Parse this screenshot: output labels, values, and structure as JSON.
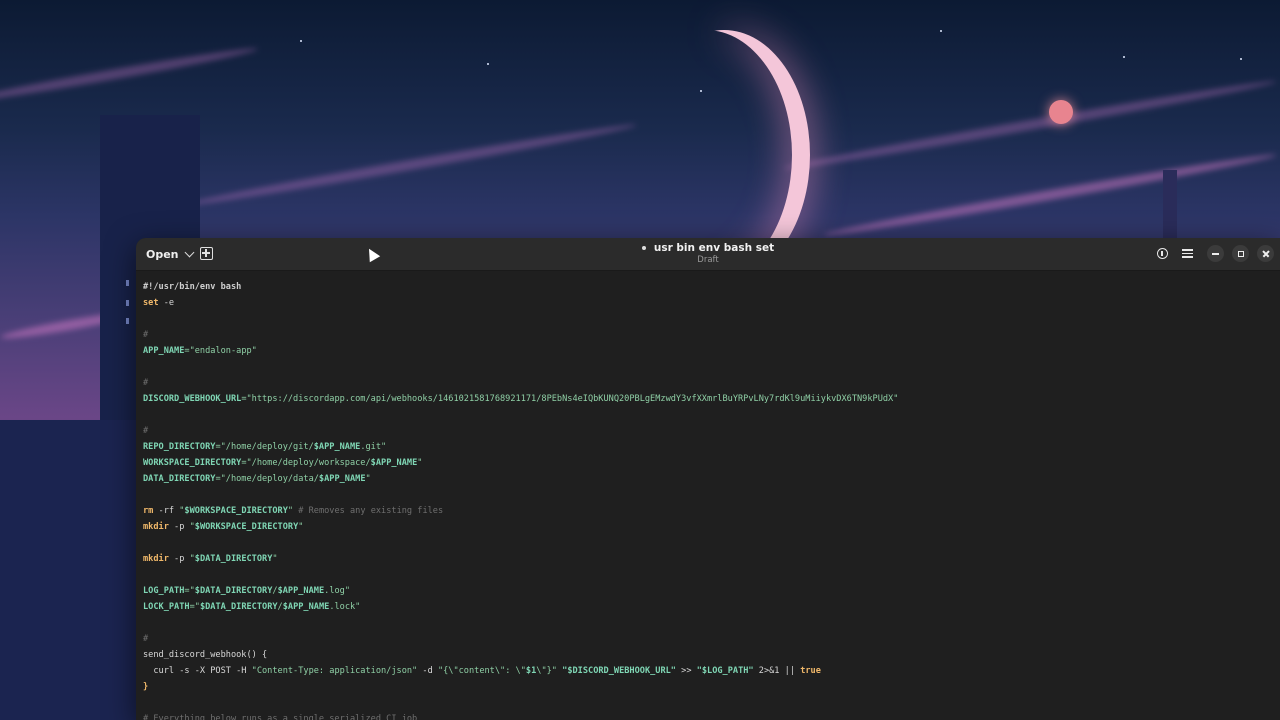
{
  "window": {
    "title": "usr bin env bash set",
    "subtitle": "Draft",
    "open_label": "Open"
  },
  "code_lines": [
    [
      {
        "t": "#!/usr/bin/env bash",
        "c": "shebang"
      }
    ],
    [
      {
        "t": "set",
        "c": "kw"
      },
      {
        "t": " -e",
        "c": "plain"
      }
    ],
    [],
    [
      {
        "t": "#",
        "c": "cmt"
      }
    ],
    [
      {
        "t": "APP_NAME",
        "c": "var"
      },
      {
        "t": "=\"endalon-app\"",
        "c": "str"
      }
    ],
    [],
    [
      {
        "t": "#",
        "c": "cmt"
      }
    ],
    [
      {
        "t": "DISCORD_WEBHOOK_URL",
        "c": "var"
      },
      {
        "t": "=\"https://discordapp.com/api/webhooks/1461021581768921171/8PEbNs4eIQbKUNQ20PBLgEMzwdY3vfXXmrlBuYRPvLNy7rdKl9uMiiykvDX6TN9kPUdX\"",
        "c": "str"
      }
    ],
    [],
    [
      {
        "t": "#",
        "c": "cmt"
      }
    ],
    [
      {
        "t": "REPO_DIRECTORY",
        "c": "var"
      },
      {
        "t": "=\"/home/deploy/git/",
        "c": "str"
      },
      {
        "t": "$APP_NAME",
        "c": "var"
      },
      {
        "t": ".git\"",
        "c": "str"
      }
    ],
    [
      {
        "t": "WORKSPACE_DIRECTORY",
        "c": "var"
      },
      {
        "t": "=\"/home/deploy/workspace/",
        "c": "str"
      },
      {
        "t": "$APP_NAME",
        "c": "var"
      },
      {
        "t": "\"",
        "c": "str"
      }
    ],
    [
      {
        "t": "DATA_DIRECTORY",
        "c": "var"
      },
      {
        "t": "=\"/home/deploy/data/",
        "c": "str"
      },
      {
        "t": "$APP_NAME",
        "c": "var"
      },
      {
        "t": "\"",
        "c": "str"
      }
    ],
    [],
    [
      {
        "t": "rm",
        "c": "kw"
      },
      {
        "t": " -rf ",
        "c": "plain"
      },
      {
        "t": "\"",
        "c": "str"
      },
      {
        "t": "$WORKSPACE_DIRECTORY",
        "c": "var"
      },
      {
        "t": "\"",
        "c": "str"
      },
      {
        "t": " # Removes any existing files",
        "c": "cmt"
      }
    ],
    [
      {
        "t": "mkdir",
        "c": "kw"
      },
      {
        "t": " -p ",
        "c": "plain"
      },
      {
        "t": "\"",
        "c": "str"
      },
      {
        "t": "$WORKSPACE_DIRECTORY",
        "c": "var"
      },
      {
        "t": "\"",
        "c": "str"
      }
    ],
    [],
    [
      {
        "t": "mkdir",
        "c": "kw"
      },
      {
        "t": " -p ",
        "c": "plain"
      },
      {
        "t": "\"",
        "c": "str"
      },
      {
        "t": "$DATA_DIRECTORY",
        "c": "var"
      },
      {
        "t": "\"",
        "c": "str"
      }
    ],
    [],
    [
      {
        "t": "LOG_PATH",
        "c": "var"
      },
      {
        "t": "=\"",
        "c": "str"
      },
      {
        "t": "$DATA_DIRECTORY",
        "c": "var"
      },
      {
        "t": "/",
        "c": "str"
      },
      {
        "t": "$APP_NAME",
        "c": "var"
      },
      {
        "t": ".log\"",
        "c": "str"
      }
    ],
    [
      {
        "t": "LOCK_PATH",
        "c": "var"
      },
      {
        "t": "=\"",
        "c": "str"
      },
      {
        "t": "$DATA_DIRECTORY",
        "c": "var"
      },
      {
        "t": "/",
        "c": "str"
      },
      {
        "t": "$APP_NAME",
        "c": "var"
      },
      {
        "t": ".lock\"",
        "c": "str"
      }
    ],
    [],
    [
      {
        "t": "#",
        "c": "cmt"
      }
    ],
    [
      {
        "t": "send_discord_webhook() {",
        "c": "plain"
      }
    ],
    [
      {
        "t": "  curl -s -X POST -H ",
        "c": "plain"
      },
      {
        "t": "\"Content-Type: application/json\"",
        "c": "str"
      },
      {
        "t": " -d ",
        "c": "plain"
      },
      {
        "t": "\"{\\\"content\\\": \\\"",
        "c": "str"
      },
      {
        "t": "$1",
        "c": "var"
      },
      {
        "t": "\\\"}\"",
        "c": "str"
      },
      {
        "t": " ",
        "c": "plain"
      },
      {
        "t": "\"$DISCORD_WEBHOOK_URL\"",
        "c": "var"
      },
      {
        "t": " >> ",
        "c": "plain"
      },
      {
        "t": "\"$LOG_PATH\"",
        "c": "var"
      },
      {
        "t": " 2>&1 || ",
        "c": "plain"
      },
      {
        "t": "true",
        "c": "kw"
      }
    ],
    [
      {
        "t": "}",
        "c": "kw"
      }
    ],
    [],
    [
      {
        "t": "# Everything below runs as a single serialized CI job",
        "c": "cmt"
      }
    ]
  ]
}
